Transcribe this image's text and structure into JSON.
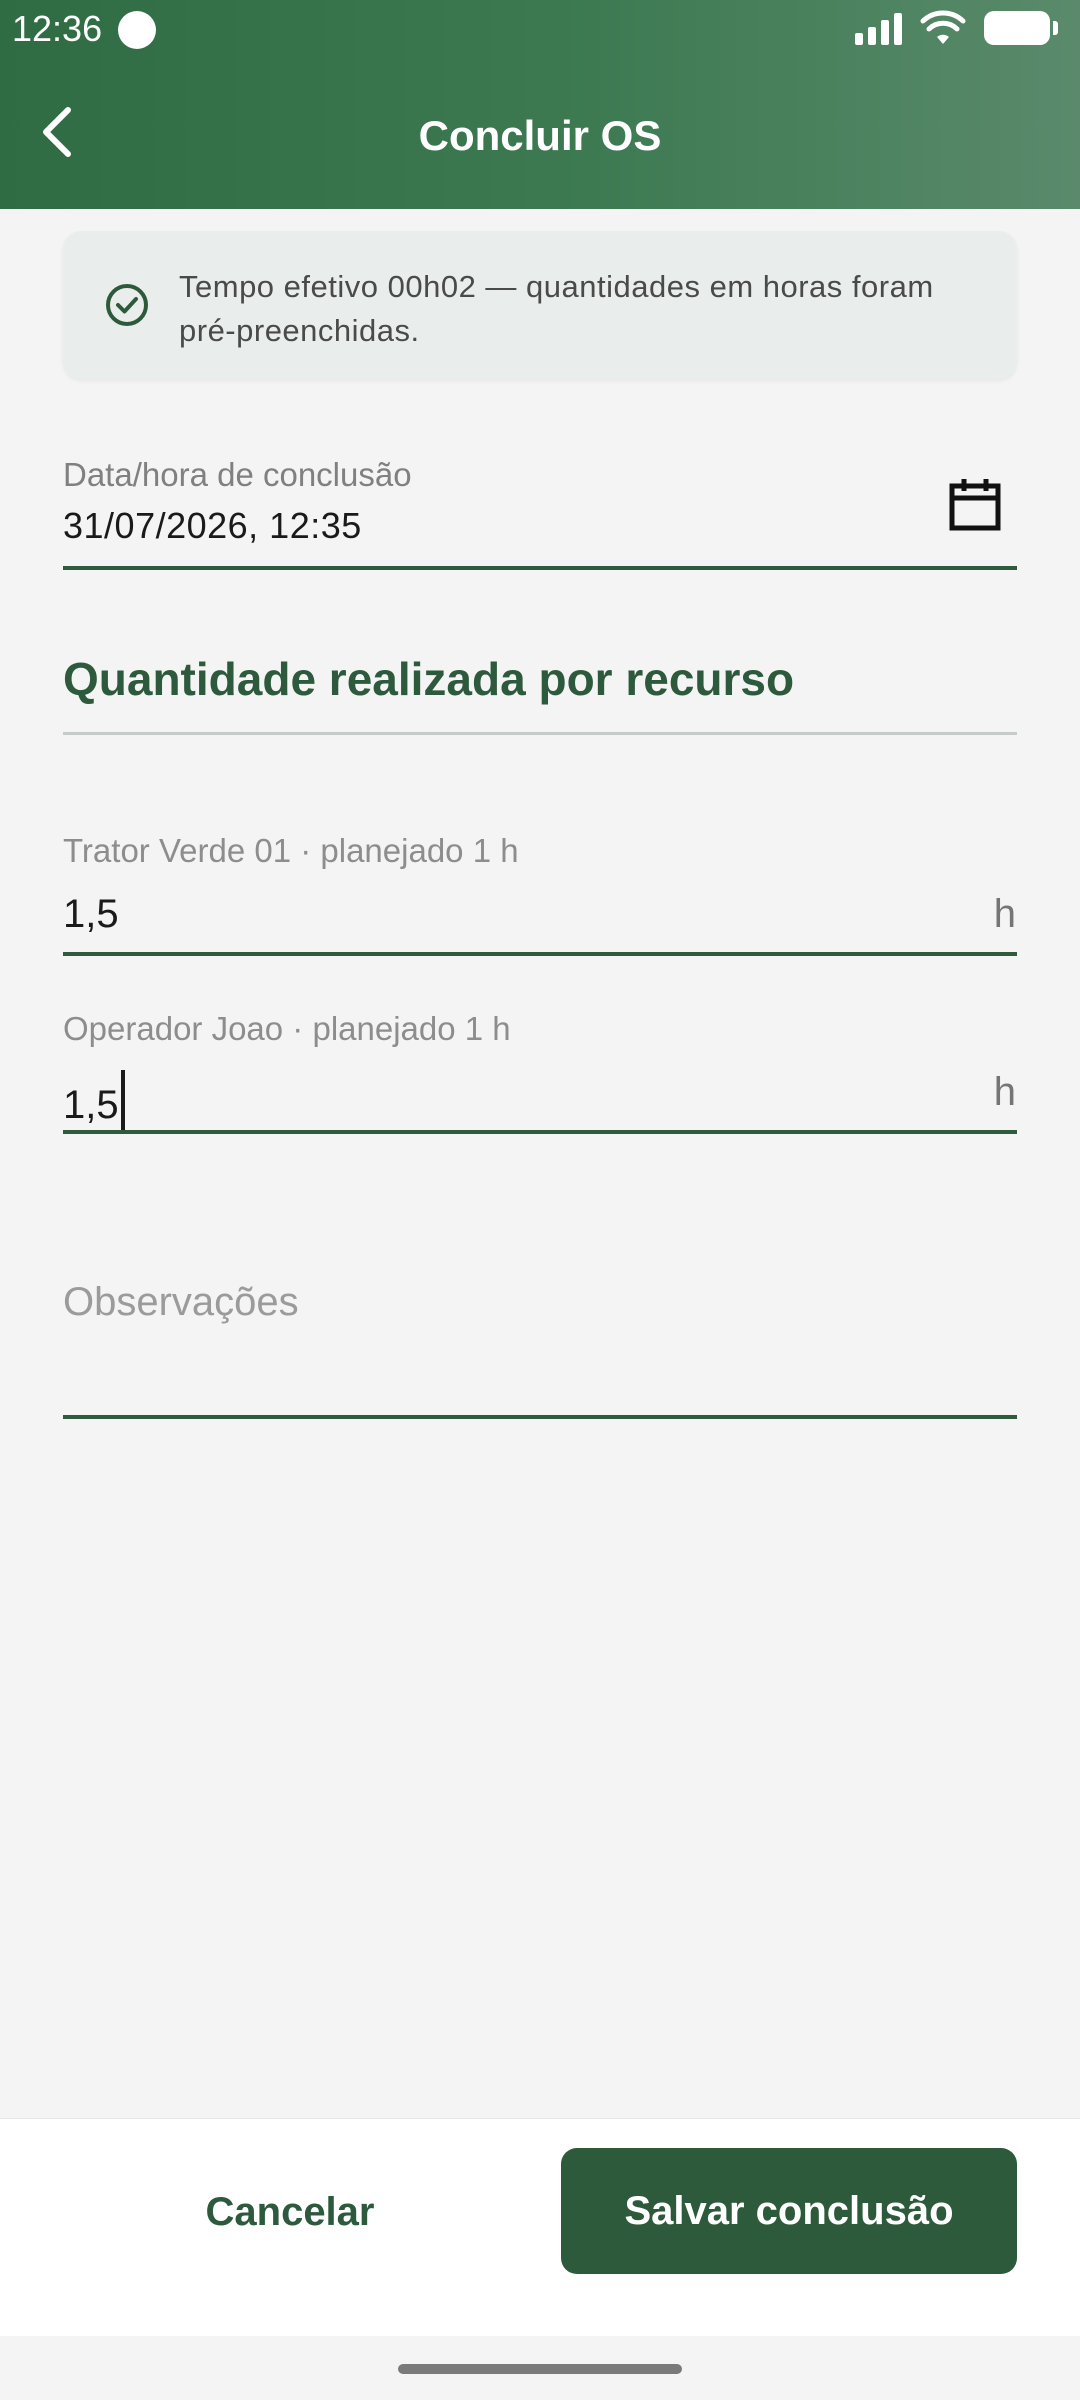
{
  "status_bar": {
    "time": "12:36"
  },
  "app_bar": {
    "title": "Concluir OS",
    "back_icon": "chevron-left-icon"
  },
  "info_card": {
    "icon": "check-circle-icon",
    "text": "Tempo efetivo 00h02 — quantidades em horas foram pré-preenchidas."
  },
  "completion_date": {
    "label": "Data/hora de conclusão",
    "value": "31/07/2026, 12:35",
    "icon": "calendar-icon"
  },
  "section": {
    "title": "Quantidade realizada por recurso"
  },
  "resources": [
    {
      "label": "Trator Verde 01 · planejado 1 h",
      "value": "1,5",
      "suffix": "h"
    },
    {
      "label": "Operador Joao · planejado 1 h",
      "value": "1,5",
      "suffix": "h"
    }
  ],
  "notes": {
    "placeholder": "Observações",
    "value": ""
  },
  "actions": {
    "cancel_label": "Cancelar",
    "save_label": "Salvar conclusão"
  },
  "colors": {
    "primary": "#2e5a3c",
    "app_bar": "#3d7a52",
    "background": "#f4f4f4"
  }
}
